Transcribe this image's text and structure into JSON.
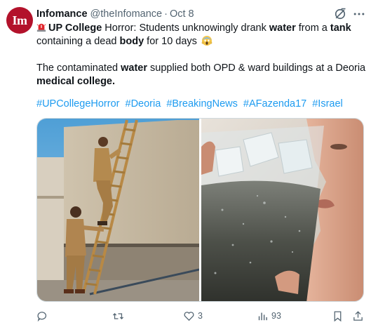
{
  "tweet": {
    "avatar_text": "Im",
    "display_name": "Infomance",
    "handle": "@theInfomance",
    "separator": "·",
    "date": "Oct 8",
    "p1": {
      "s1": "UP College",
      "s2": " Horror: Students unknowingly drank ",
      "s3": "water",
      "s4": " from a ",
      "s5": "tank",
      "s6": " containing a dead ",
      "s7": "body",
      "s8": " for 10 days"
    },
    "p2": {
      "s1": "The contaminated ",
      "s2": "water",
      "s3": " supplied both OPD & ward buildings at a Deoria ",
      "s4": "medical college."
    },
    "hashtags": [
      "#UPCollegeHorror",
      "#Deoria",
      "#BreakingNews",
      "#AFazenda17",
      "#Israel"
    ],
    "icons": {
      "alarm": "rotating-light-emoji",
      "scream": "face-screaming-in-fear-emoji",
      "grok": "grok-icon",
      "more": "more-icon"
    }
  },
  "actions": {
    "reply_count": "",
    "retweet_count": "",
    "like_count": "3",
    "views_count": "93"
  },
  "colors": {
    "accent": "#1d9bf0",
    "text": "#0f1419",
    "muted": "#536471",
    "avatar": "#b3122b"
  }
}
